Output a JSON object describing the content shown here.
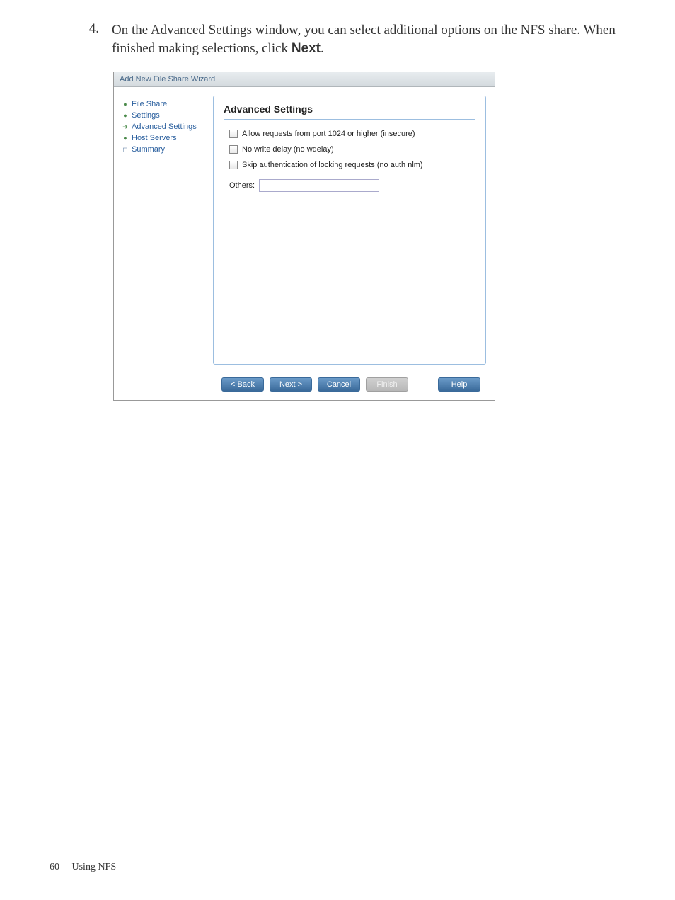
{
  "instruction": {
    "number": "4.",
    "text_part1": "On the Advanced Settings window, you can select additional options on the NFS share. When finished making selections, click ",
    "bold": "Next",
    "text_part2": "."
  },
  "wizard": {
    "title": "Add New File Share Wizard",
    "sidebar": {
      "items": [
        {
          "icon": "dot",
          "label": "File Share"
        },
        {
          "icon": "dot",
          "label": "Settings"
        },
        {
          "icon": "arrow",
          "label": "Advanced Settings"
        },
        {
          "icon": "dot",
          "label": "Host Servers"
        },
        {
          "icon": "box",
          "label": "Summary"
        }
      ]
    },
    "heading": "Advanced Settings",
    "checkboxes": [
      {
        "label": "Allow requests from port 1024 or higher (insecure)"
      },
      {
        "label": "No write delay (no wdelay)"
      },
      {
        "label": "Skip authentication of locking requests (no auth nlm)"
      }
    ],
    "others_label": "Others:",
    "buttons": {
      "back": "< Back",
      "next": "Next >",
      "cancel": "Cancel",
      "finish": "Finish",
      "help": "Help"
    }
  },
  "footer": {
    "page": "60",
    "section": "Using NFS"
  }
}
